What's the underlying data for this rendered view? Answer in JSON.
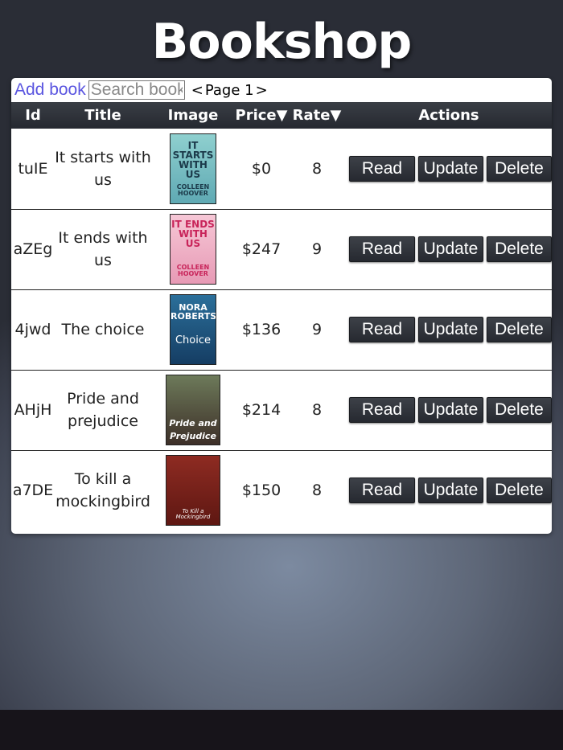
{
  "app": {
    "title": "Bookshop"
  },
  "toolbar": {
    "add_label": "Add book",
    "search_placeholder": "Search book",
    "search_value": ""
  },
  "pager": {
    "prev": "<",
    "label": "Page 1",
    "next": ">"
  },
  "table": {
    "headers": {
      "id": "Id",
      "title": "Title",
      "image": "Image",
      "price": "Price",
      "rate": "Rate",
      "actions": "Actions"
    },
    "sort_indicator": "▼",
    "actions": {
      "read": "Read",
      "update": "Update",
      "delete": "Delete"
    },
    "rows": [
      {
        "id": "tuIE",
        "title": "It starts with us",
        "price": "$0",
        "rate": "8",
        "cover": {
          "colors": [
            "#8fd0cf",
            "#5fa9b3"
          ],
          "text": "IT STARTS WITH US",
          "author": "COLLEEN HOOVER"
        }
      },
      {
        "id": "aZEg",
        "title": "It ends with us",
        "price": "$247",
        "rate": "9",
        "cover": {
          "colors": [
            "#f6c7d6",
            "#e79ab5"
          ],
          "text": "IT ENDS WITH US",
          "author": "COLLEEN HOOVER"
        }
      },
      {
        "id": "4jwd",
        "title": "The choice",
        "price": "$136",
        "rate": "9",
        "cover": {
          "colors": [
            "#2b6f9a",
            "#153d63"
          ],
          "text": "NORA ROBERTS",
          "author": "Choice"
        }
      },
      {
        "id": "AHjH",
        "title": "Pride and prejudice",
        "price": "$214",
        "rate": "8",
        "cover": {
          "colors": [
            "#6d7a5a",
            "#3d2f28"
          ],
          "text": "Pride and Prejudice",
          "author": ""
        }
      },
      {
        "id": "a7DE",
        "title": "To kill a mockingbird",
        "price": "$150",
        "rate": "8",
        "cover": {
          "colors": [
            "#8e2b22",
            "#5e1712"
          ],
          "text": "To Kill a Mockingbird",
          "author": ""
        }
      }
    ]
  }
}
